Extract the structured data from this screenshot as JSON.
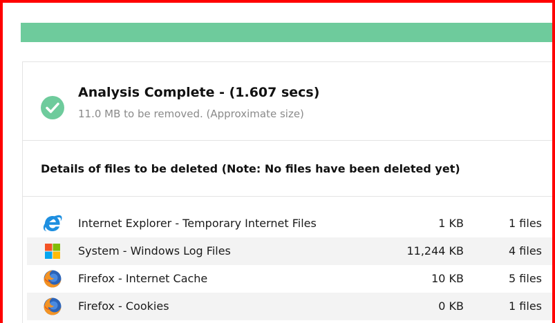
{
  "progress": {
    "percent": 100,
    "color": "#6ecb9c"
  },
  "analysis": {
    "title": "Analysis Complete - (1.607 secs)",
    "subtitle": "11.0 MB to be removed. (Approximate size)",
    "status_icon": "check-circle-icon",
    "status_color": "#6ecb9c"
  },
  "details": {
    "heading": "Details of files to be deleted (Note: No files have been deleted yet)",
    "rows": [
      {
        "icon": "internet-explorer-icon",
        "name": "Internet Explorer - Temporary Internet Files",
        "size": "1 KB",
        "count": "1 files"
      },
      {
        "icon": "windows-icon",
        "name": "System - Windows Log Files",
        "size": "11,244 KB",
        "count": "4 files"
      },
      {
        "icon": "firefox-icon",
        "name": "Firefox - Internet Cache",
        "size": "10 KB",
        "count": "5 files"
      },
      {
        "icon": "firefox-icon",
        "name": "Firefox - Cookies",
        "size": "0 KB",
        "count": "1 files"
      }
    ]
  }
}
